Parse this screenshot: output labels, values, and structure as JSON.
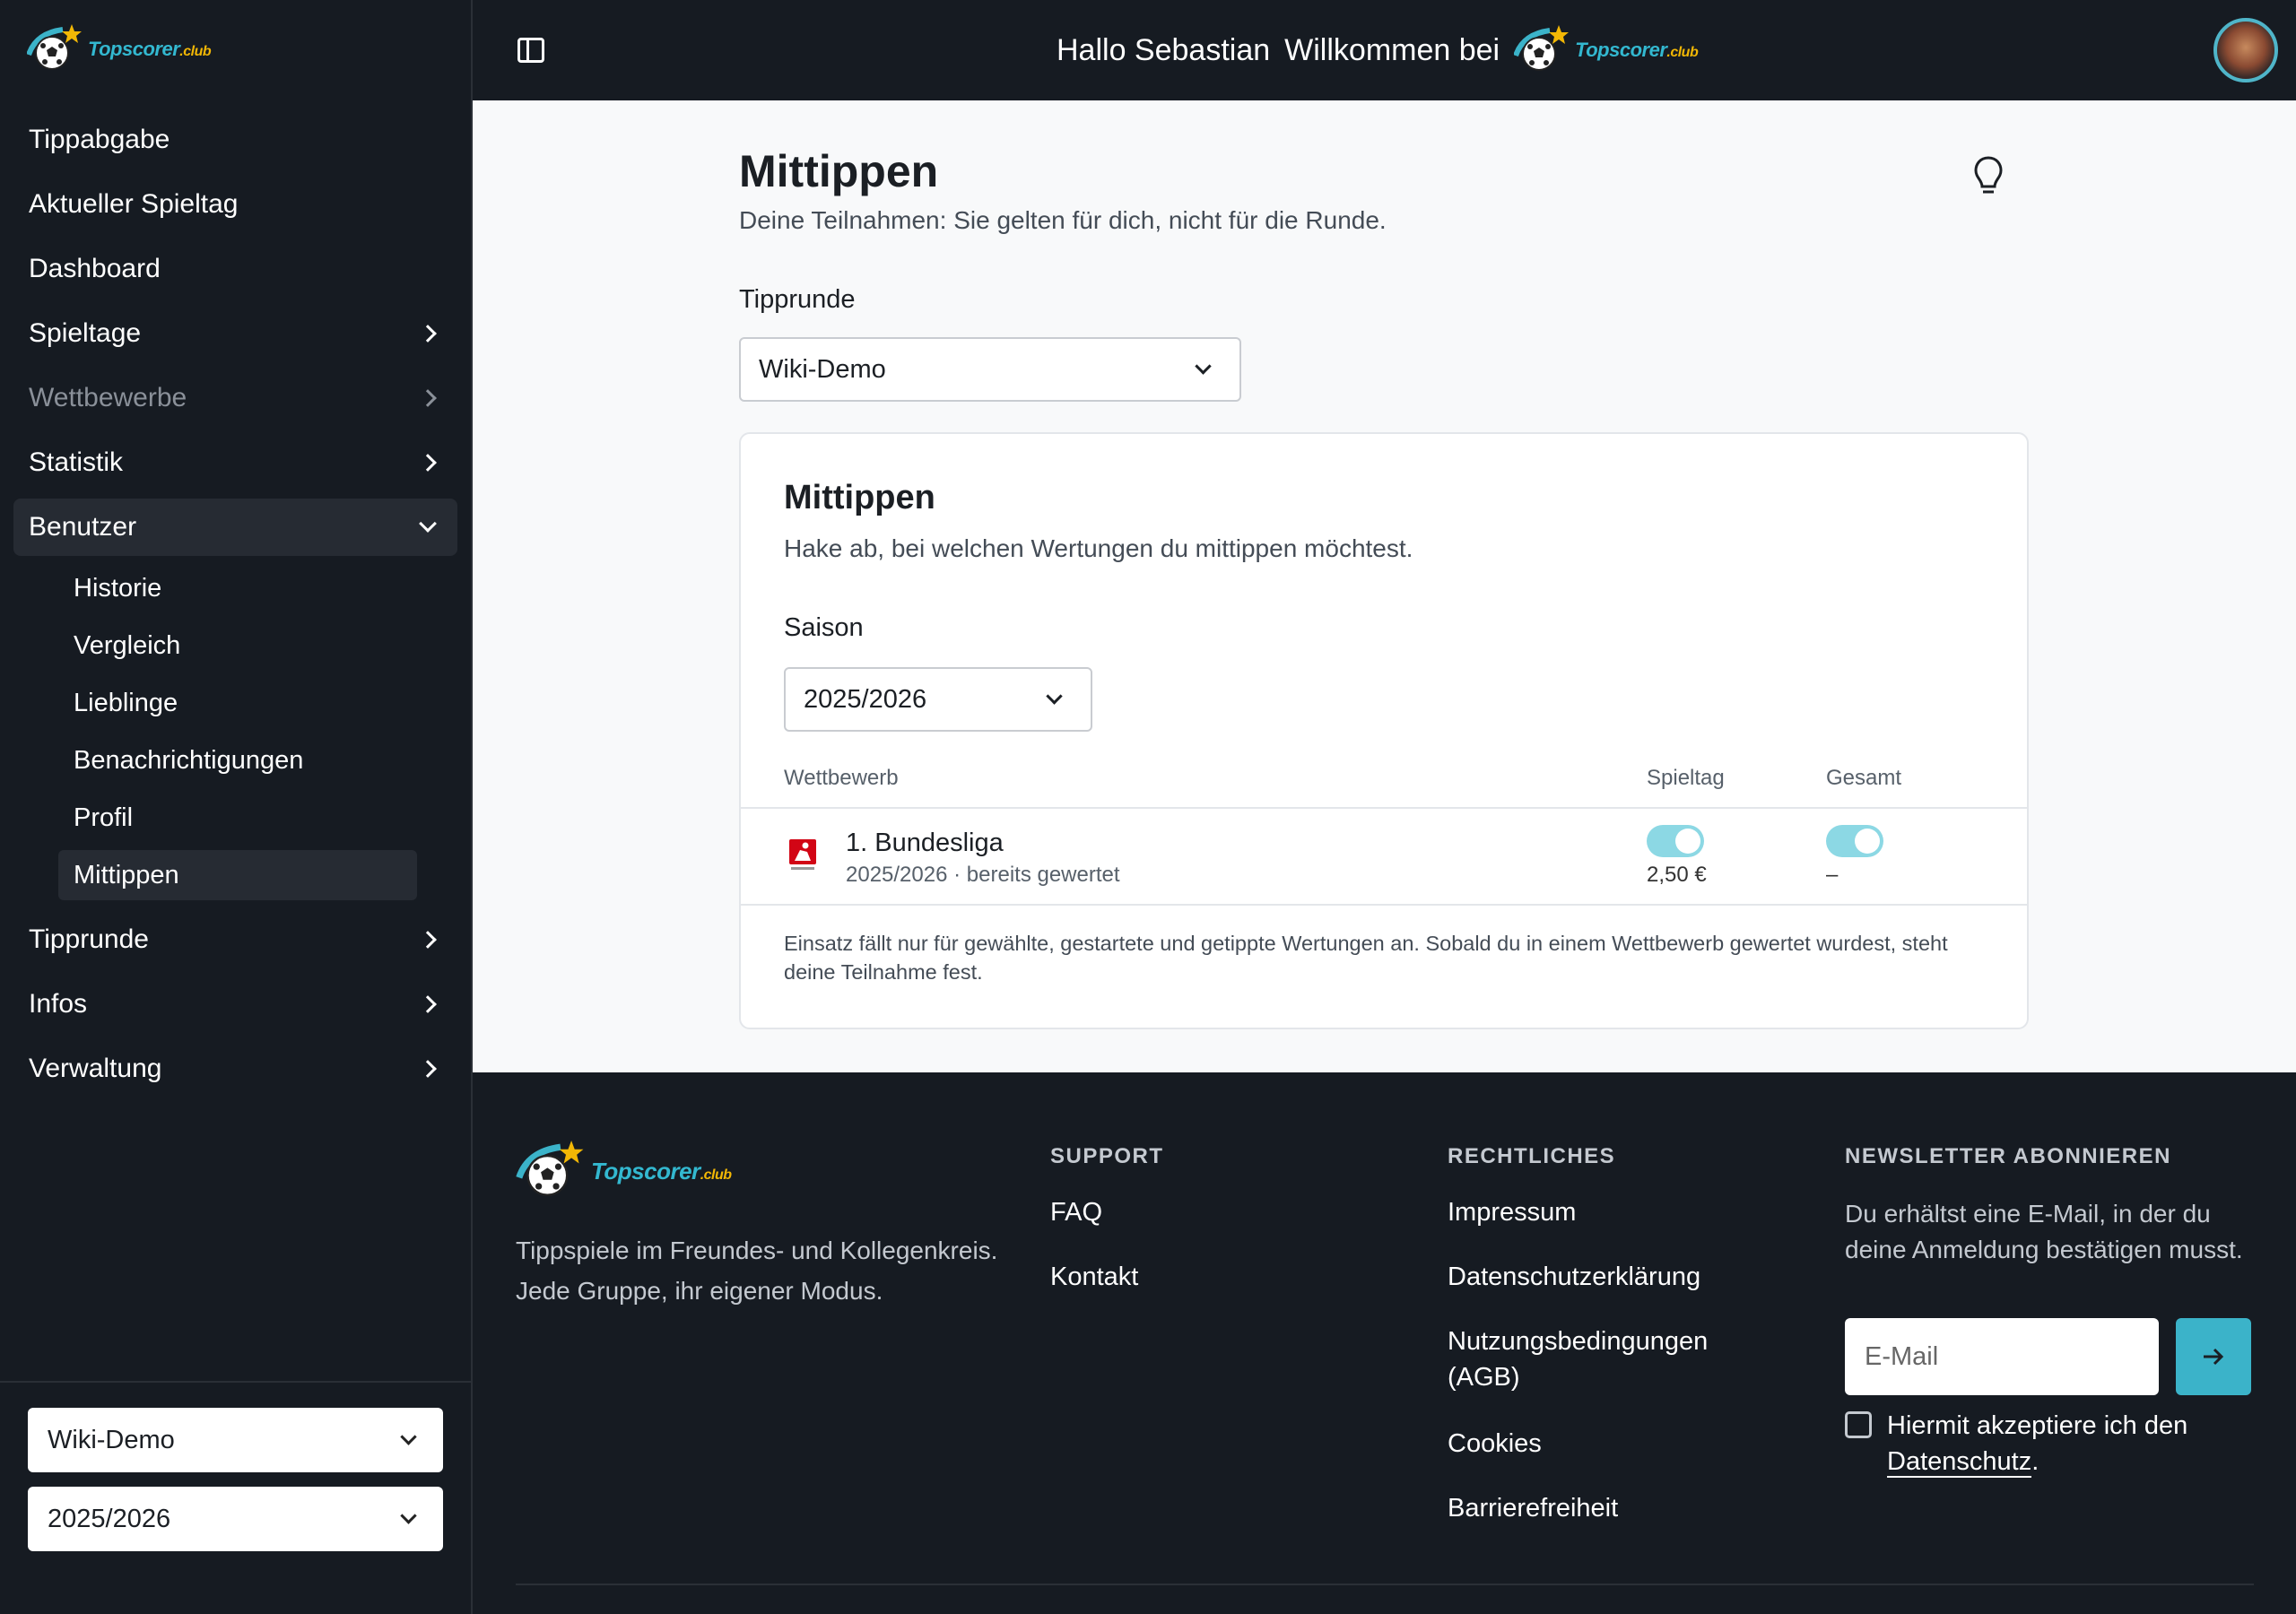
{
  "brand": {
    "name": "Topscorer",
    "suffix": ".club"
  },
  "header": {
    "greeting": "Hallo Sebastian",
    "welcome": "Willkommen bei"
  },
  "sidebar": {
    "items": [
      {
        "label": "Tippabgabe"
      },
      {
        "label": "Aktueller Spieltag"
      },
      {
        "label": "Dashboard"
      },
      {
        "label": "Spieltage"
      },
      {
        "label": "Wettbewerbe"
      },
      {
        "label": "Statistik"
      },
      {
        "label": "Benutzer"
      },
      {
        "label": "Tipprunde"
      },
      {
        "label": "Infos"
      },
      {
        "label": "Verwaltung"
      }
    ],
    "sub_items": [
      {
        "label": "Historie"
      },
      {
        "label": "Vergleich"
      },
      {
        "label": "Lieblinge"
      },
      {
        "label": "Benachrichtigungen"
      },
      {
        "label": "Profil"
      },
      {
        "label": "Mittippen"
      }
    ],
    "round_select": "Wiki-Demo",
    "season_select": "2025/2026"
  },
  "main": {
    "title": "Mittippen",
    "subtitle": "Deine Teilnahmen: Sie gelten für dich, nicht für die Runde.",
    "round_label": "Tipprunde",
    "round_value": "Wiki-Demo",
    "card": {
      "title": "Mittippen",
      "subtitle": "Hake ab, bei welchen Wertungen du mittippen möchtest.",
      "season_label": "Saison",
      "season_value": "2025/2026",
      "columns": {
        "competition": "Wettbewerb",
        "matchday": "Spieltag",
        "total": "Gesamt"
      },
      "rows": [
        {
          "name": "1. Bundesliga",
          "meta": "2025/2026 · bereits gewertet",
          "matchday_on": true,
          "matchday_amount": "2,50 €",
          "total_on": true,
          "total_amount": "–"
        }
      ],
      "note": "Einsatz fällt nur für gewählte, gestartete und getippte Wertungen an. Sobald du in einem Wettbewerb gewertet wurdest, steht deine Teilnahme fest."
    }
  },
  "footer": {
    "description": "Tippspiele im Freundes- und Kollegenkreis. Jede Gruppe, ihr eigener Modus.",
    "support": {
      "heading": "SUPPORT",
      "links": [
        "FAQ",
        "Kontakt"
      ]
    },
    "legal": {
      "heading": "RECHTLICHES",
      "links": [
        "Impressum",
        "Datenschutzerklärung",
        "Nutzungsbedingungen (AGB)",
        "Cookies",
        "Barrierefreiheit"
      ]
    },
    "newsletter": {
      "heading": "NEWSLETTER ABONNIEREN",
      "text": "Du erhältst eine E-Mail, in der du deine Anmeldung bestätigen musst.",
      "placeholder": "E-Mail",
      "consent_prefix": "Hiermit akzeptiere ich den",
      "consent_link": "Datenschutz",
      "consent_suffix": "."
    }
  },
  "colors": {
    "accent": "#3bb3c9",
    "dark": "#161b22",
    "toggle": "#8cd8e4"
  }
}
